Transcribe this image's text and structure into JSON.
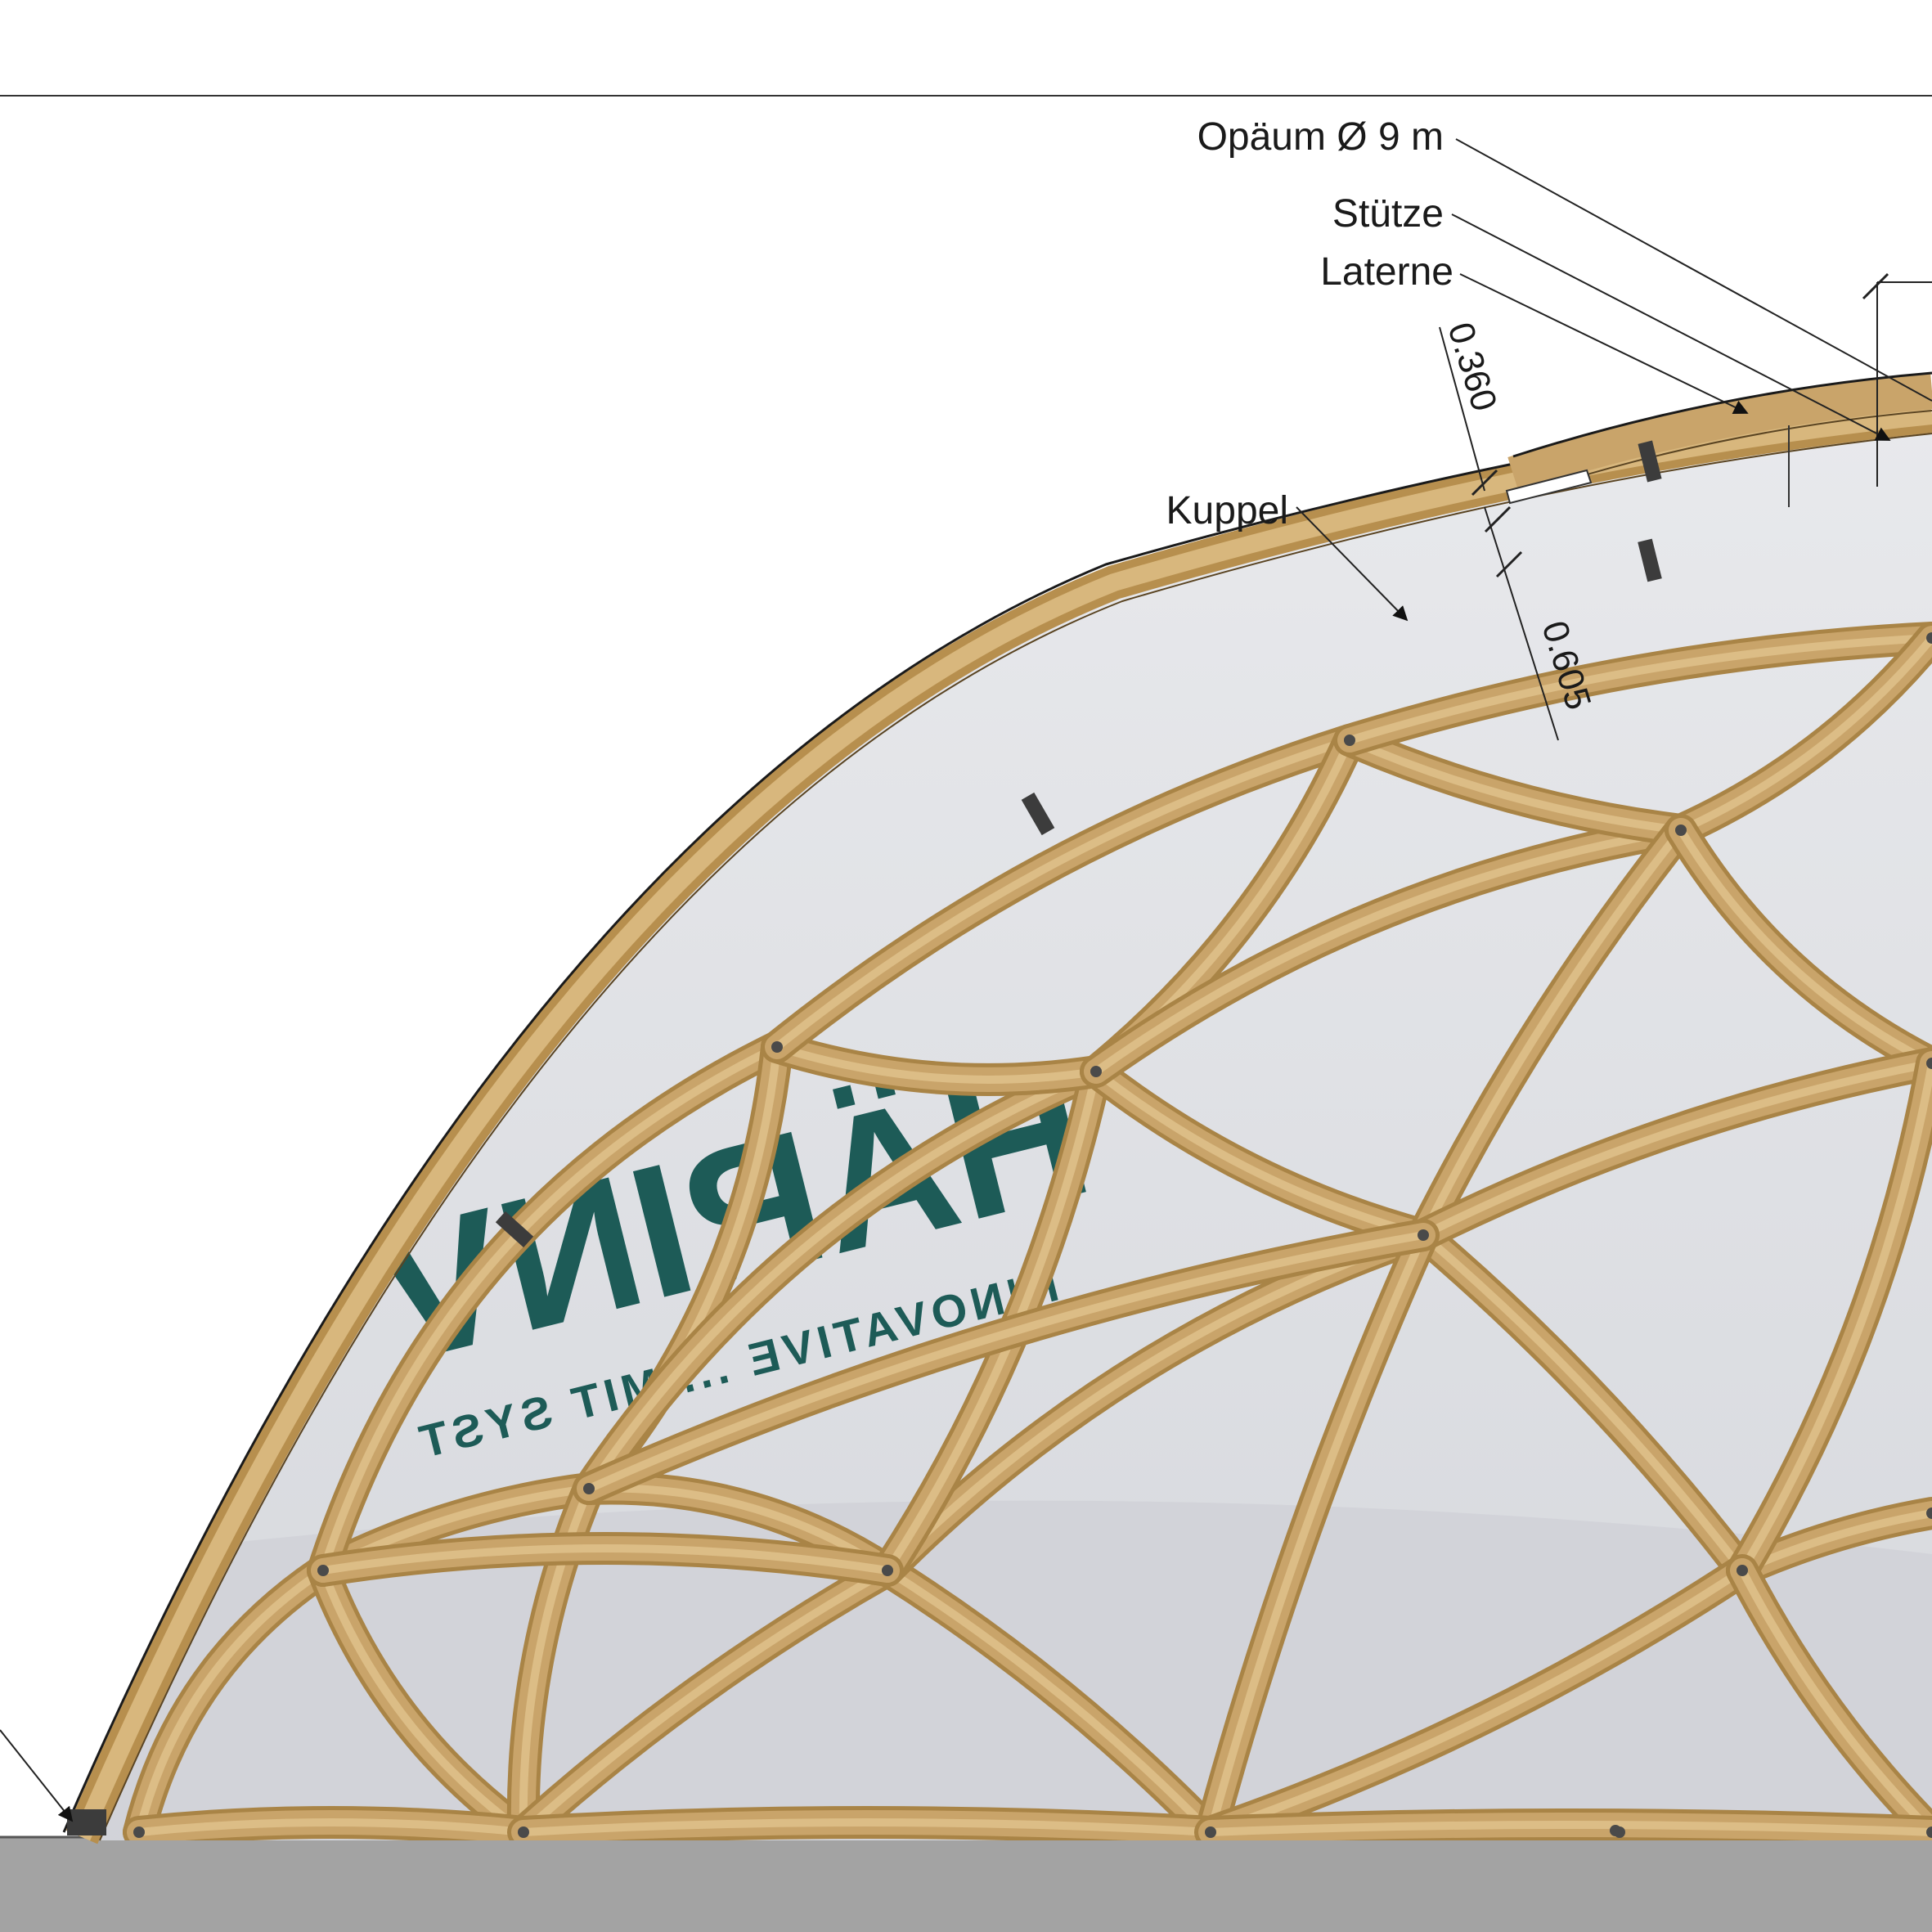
{
  "labels": {
    "oculus": "Opäum Ø 9 m",
    "column": "Stütze",
    "lantern": "Laterne",
    "dome": "Kuppel"
  },
  "dimensions": {
    "lantern_height": "0.360",
    "dome_thickness": "0.605"
  },
  "membrane_print": {
    "brand": "HÄRINV",
    "tagline": "INNOVATIVE ... MIT SYST"
  },
  "colors": {
    "timber": "#c9a46a",
    "timber_dark": "#a98446",
    "timber_light": "#dcbd86",
    "membrane": "#e6e7ea",
    "membrane_shadow": "#c9cbd1",
    "ground": "#a3a3a3",
    "line": "#1a1a1a",
    "brand_green": "#1d5b57",
    "connector": "#4a4a4a"
  }
}
